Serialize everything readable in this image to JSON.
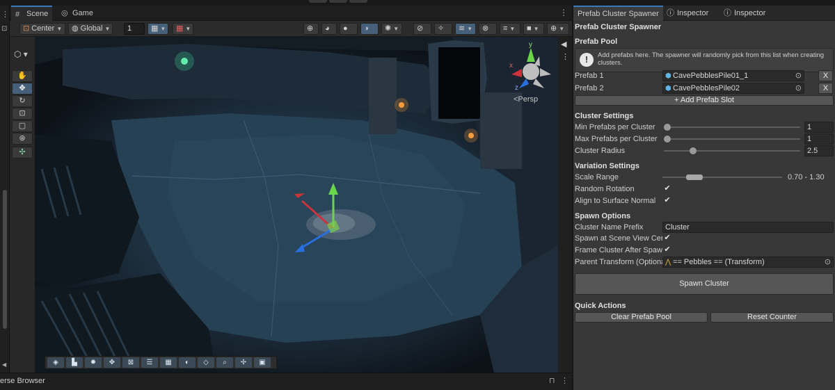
{
  "scene_tabs": {
    "scene": "Scene",
    "game": "Game"
  },
  "toolbar": {
    "pivot": "Center",
    "space": "Global",
    "grid_snap": "1"
  },
  "viewport": {
    "persp_label": "<Persp",
    "gizmo_axes": {
      "x": "x",
      "y": "y",
      "z": "z"
    }
  },
  "bottom": {
    "panel_label": "erse Browser"
  },
  "inspector_tabs": [
    {
      "label": "Prefab Cluster Spawner",
      "icon": "none"
    },
    {
      "label": "Inspector",
      "icon": "info-icon"
    },
    {
      "label": "Inspector",
      "icon": "info-icon"
    }
  ],
  "spawner": {
    "title": "Prefab Cluster Spawner",
    "pool": {
      "header": "Prefab Pool",
      "help": "Add prefabs here. The spawner will randomly pick from this list when creating clusters.",
      "items": [
        {
          "label": "Prefab 1",
          "value": "CavePebblesPile01_1"
        },
        {
          "label": "Prefab 2",
          "value": "CavePebblesPile02"
        }
      ],
      "remove_label": "X",
      "add_label": "+ Add Prefab Slot"
    },
    "cluster": {
      "header": "Cluster Settings",
      "min_label": "Min Prefabs per Cluster",
      "min_value": "1",
      "min_fraction": 0.0,
      "max_label": "Max Prefabs per Cluster",
      "max_value": "1",
      "max_fraction": 0.0,
      "radius_label": "Cluster Radius",
      "radius_value": "2.5",
      "radius_fraction": 0.2
    },
    "variation": {
      "header": "Variation Settings",
      "scale_label": "Scale Range",
      "scale_value": "0.70 - 1.30",
      "scale_min_fraction": 0.2,
      "scale_max_fraction": 0.34,
      "rotation_label": "Random Rotation",
      "rotation_checked": true,
      "align_label": "Align to Surface Normal",
      "align_checked": true
    },
    "spawn": {
      "header": "Spawn Options",
      "prefix_label": "Cluster Name Prefix",
      "prefix_value": "Cluster",
      "center_label": "Spawn at Scene View Center",
      "center_checked": true,
      "frame_label": "Frame Cluster After Spawn",
      "frame_checked": true,
      "parent_label": "Parent Transform (Optional)",
      "parent_value": "== Pebbles == (Transform)",
      "button": "Spawn Cluster"
    },
    "quick": {
      "header": "Quick Actions",
      "clear": "Clear Prefab Pool",
      "reset": "Reset Counter"
    }
  },
  "colors": {
    "accent": "#3a79bb",
    "panel": "#383838",
    "viewport": "#223648"
  }
}
